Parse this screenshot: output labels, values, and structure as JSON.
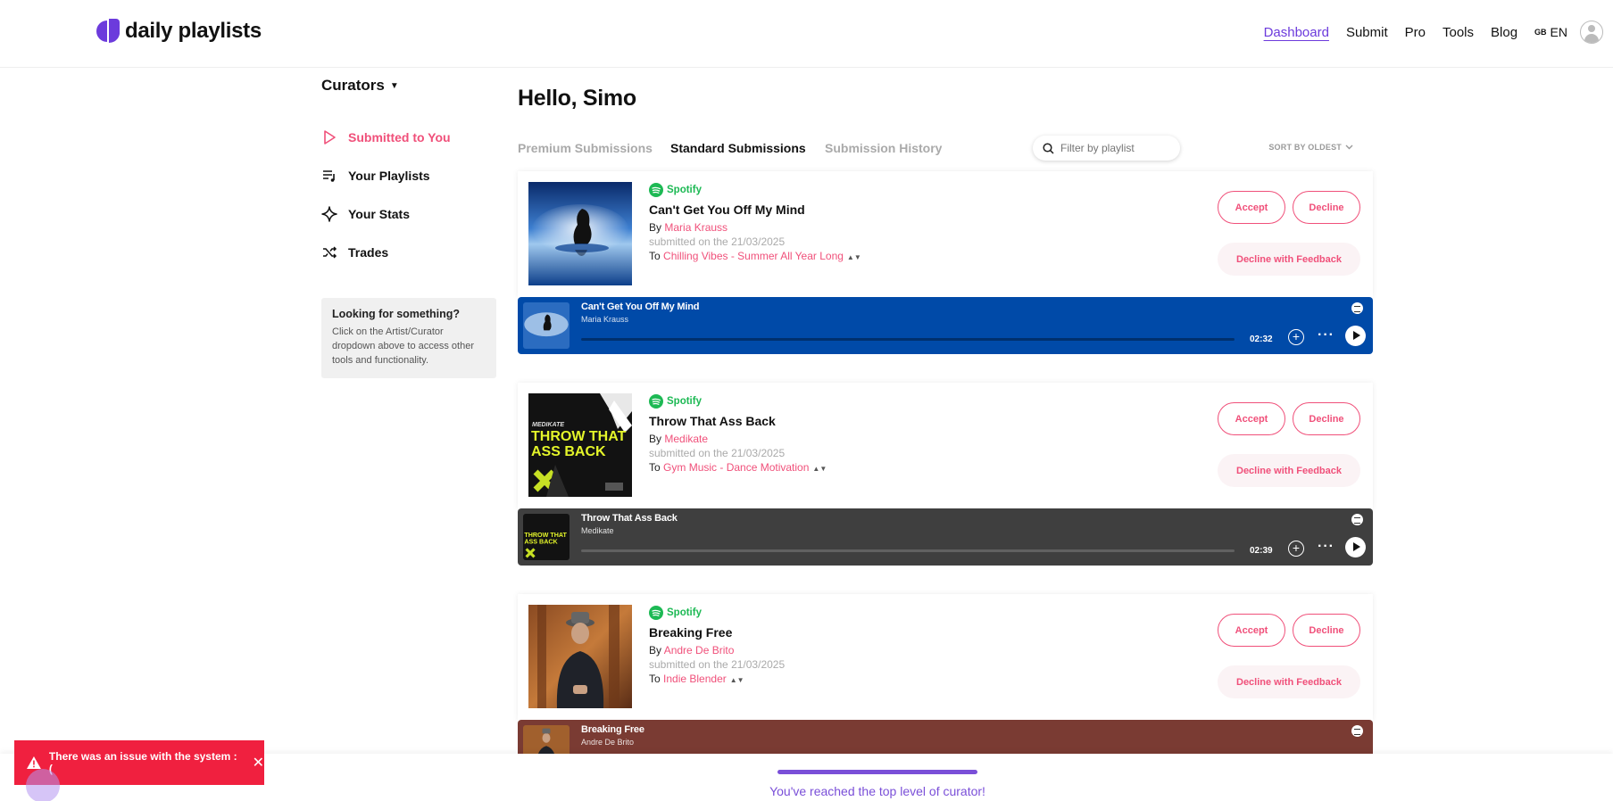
{
  "header": {
    "logo_text": "daily playlists",
    "nav": [
      "Dashboard",
      "Submit",
      "Pro",
      "Tools",
      "Blog"
    ],
    "lang_flag": "GB",
    "lang": "EN"
  },
  "sidebar": {
    "dropdown": "Curators",
    "items": [
      {
        "label": "Submitted to You",
        "icon": "play-outline-icon"
      },
      {
        "label": "Your Playlists",
        "icon": "playlist-icon"
      },
      {
        "label": "Your Stats",
        "icon": "sparkle-icon"
      },
      {
        "label": "Trades",
        "icon": "shuffle-icon"
      }
    ],
    "help_title": "Looking for something?",
    "help_text": "Click on the Artist/Curator dropdown above to access other tools and functionality."
  },
  "main": {
    "greeting": "Hello, Simo",
    "tabs": [
      "Premium Submissions",
      "Standard Submissions",
      "Submission History"
    ],
    "filter_placeholder": "Filter by playlist",
    "sort_label": "SORT BY OLDEST",
    "by_prefix": "By",
    "submitted_prefix": "submitted on the",
    "to_prefix": "To",
    "platform": "Spotify",
    "buttons": {
      "accept": "Accept",
      "decline": "Decline",
      "feedback": "Decline with Feedback"
    }
  },
  "submissions": [
    {
      "title": "Can't Get You Off My Mind",
      "artist": "Maria Krauss",
      "date": "21/03/2025",
      "playlist": "Chilling Vibes - Summer All Year Long",
      "player_title": "Can't Get You Off My Mind",
      "player_artist": "Maria Krauss",
      "duration": "02:32",
      "player_color": "#004aa8"
    },
    {
      "title": "Throw That Ass Back",
      "artist": "Medikate",
      "date": "21/03/2025",
      "playlist": "Gym Music - Dance Motivation",
      "player_title": "Throw That Ass Back",
      "player_artist": "Medikate",
      "duration": "02:39",
      "player_color": "#3f3f3f"
    },
    {
      "title": "Breaking Free",
      "artist": "Andre De Brito",
      "date": "21/03/2025",
      "playlist": "Indie Blender",
      "player_title": "Breaking Free",
      "player_artist": "Andre De Brito",
      "duration": "",
      "player_color": "#7a3b33"
    }
  ],
  "album_art_text": {
    "medikate_label": "MEDIKATE",
    "medikate_cover": "THROW THAT ASS BACK"
  },
  "bottom": {
    "level_text": "You've reached the top level of curator!"
  },
  "toast": {
    "message": "There was an issue with the system :("
  },
  "colors": {
    "accent": "#6c3bdc",
    "pink": "#f0507a",
    "spotify": "#1db954",
    "error": "#f0203f"
  }
}
